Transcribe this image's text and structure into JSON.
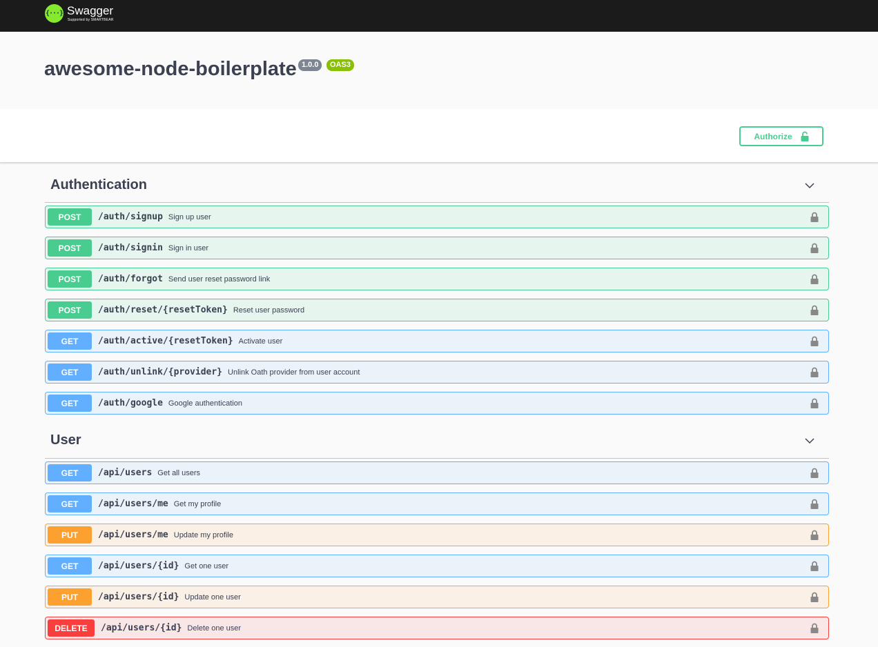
{
  "topbar": {
    "logo_symbol": "{···}",
    "logo_name": "Swagger",
    "logo_sub": "Supported by SMARTBEAR"
  },
  "info": {
    "title": "awesome-node-boilerplate",
    "version": "1.0.0",
    "oas_badge": "OAS3"
  },
  "scheme": {
    "authorize_label": "Authorize"
  },
  "colors": {
    "post": "#49cc90",
    "get": "#61affe",
    "put": "#fca130",
    "delete": "#f93e3e"
  },
  "tags": [
    {
      "name": "Authentication",
      "operations": [
        {
          "method": "POST",
          "path": "/auth/signup",
          "summary": "Sign up user"
        },
        {
          "method": "POST",
          "path": "/auth/signin",
          "summary": "Sign in user"
        },
        {
          "method": "POST",
          "path": "/auth/forgot",
          "summary": "Send user reset password link"
        },
        {
          "method": "POST",
          "path": "/auth/reset/{resetToken}",
          "summary": "Reset user password"
        },
        {
          "method": "GET",
          "path": "/auth/active/{resetToken}",
          "summary": "Activate user"
        },
        {
          "method": "GET",
          "path": "/auth/unlink/{provider}",
          "summary": "Unlink Oath provider from user account"
        },
        {
          "method": "GET",
          "path": "/auth/google",
          "summary": "Google authentication"
        }
      ]
    },
    {
      "name": "User",
      "operations": [
        {
          "method": "GET",
          "path": "/api/users",
          "summary": "Get all users"
        },
        {
          "method": "GET",
          "path": "/api/users/me",
          "summary": "Get my profile"
        },
        {
          "method": "PUT",
          "path": "/api/users/me",
          "summary": "Update my profile"
        },
        {
          "method": "GET",
          "path": "/api/users/{id}",
          "summary": "Get one user"
        },
        {
          "method": "PUT",
          "path": "/api/users/{id}",
          "summary": "Update one user"
        },
        {
          "method": "DELETE",
          "path": "/api/users/{id}",
          "summary": "Delete one user"
        }
      ]
    }
  ]
}
